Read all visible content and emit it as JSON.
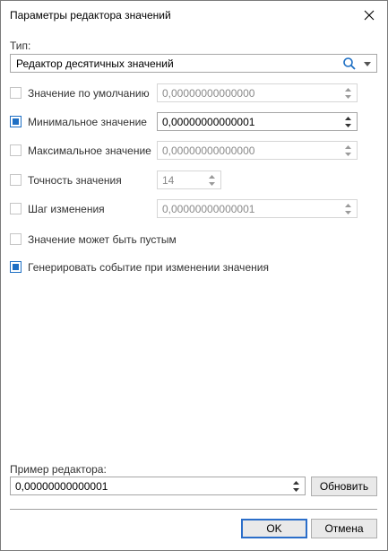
{
  "dialog": {
    "title": "Параметры редактора значений"
  },
  "type": {
    "label": "Тип:",
    "value": "Редактор десятичных значений"
  },
  "rows": [
    {
      "label": "Значение по умолчанию",
      "checked": false,
      "value": "0,00000000000000"
    },
    {
      "label": "Минимальное значение",
      "checked": true,
      "value": "0,00000000000001"
    },
    {
      "label": "Максимальное значение",
      "checked": false,
      "value": "0,00000000000000"
    },
    {
      "label": "Точность значения",
      "checked": false,
      "value": "14"
    },
    {
      "label": "Шаг изменения",
      "checked": false,
      "value": "0,00000000000001"
    }
  ],
  "options": [
    {
      "label": "Значение может быть пустым",
      "checked": false
    },
    {
      "label": "Генерировать событие при изменении значения",
      "checked": true
    }
  ],
  "preview": {
    "label": "Пример редактора:",
    "value": "0,00000000000001",
    "refresh_label": "Обновить"
  },
  "buttons": {
    "ok": "OK",
    "cancel": "Отмена"
  },
  "colors": {
    "accent": "#1e6fc4"
  }
}
